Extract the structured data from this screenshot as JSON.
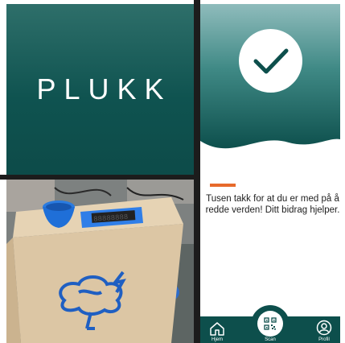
{
  "logo": {
    "text": "PLUKK"
  },
  "photo": {
    "display_text": "88888888",
    "description_icon": "brain-lightning-logo"
  },
  "phone": {
    "status_icon": "checkmark-icon",
    "message": "Tusen takk for at du er med på å redde verden! Ditt bidrag hjelper.",
    "colors": {
      "primary": "#0d4f4c",
      "accent": "#e76a2b"
    },
    "nav": {
      "items": [
        {
          "label": "Hjem",
          "icon": "home-icon"
        },
        {
          "label": "Scan",
          "icon": "qr-code-icon"
        },
        {
          "label": "Profil",
          "icon": "user-icon"
        }
      ]
    }
  }
}
